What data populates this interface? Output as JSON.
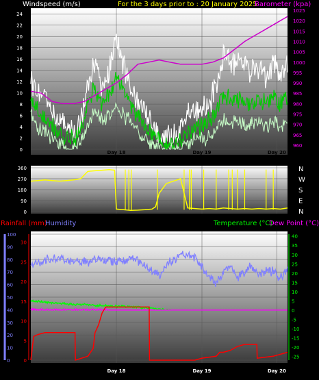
{
  "header": {
    "left_label": "Windspeed (m/s)",
    "center_label": "For the 3 days prior to : 20 January 2025",
    "right_label": "Barometer (kpa)"
  },
  "colors": {
    "background": "#000000",
    "wind_gust": "#ffffff",
    "wind_avg": "#00cc00",
    "wind_min": "#c8ffc8",
    "barometer": "#cc00cc",
    "direction": "#ffff00",
    "rainfall": "#ff0000",
    "humidity": "#8080ff",
    "temperature": "#00ff00",
    "dewpoint": "#ff00ff",
    "grid": "#555555"
  },
  "chart_data": [
    {
      "type": "line",
      "name": "wind-barometer",
      "x_tick_labels": [
        "Day 18",
        "Day 19",
        "Day 20"
      ],
      "y_left_ticks": [
        "0",
        "2",
        "4",
        "6",
        "8",
        "10",
        "12",
        "14",
        "16",
        "18",
        "20",
        "22",
        "24"
      ],
      "y_right_ticks": [
        "960",
        "965",
        "970",
        "975",
        "980",
        "985",
        "990",
        "995",
        "1000",
        "1005",
        "1010",
        "1015",
        "1020",
        "1025"
      ],
      "ylim_left": [
        0,
        25
      ],
      "ylim_right": [
        958,
        1026
      ],
      "xlim": [
        0,
        72
      ],
      "series": [
        {
          "role": "gust",
          "x": [
            0,
            2,
            4,
            6,
            8,
            10,
            12,
            14,
            16,
            18,
            20,
            22,
            24,
            26,
            28,
            30,
            32,
            34,
            36,
            38,
            40,
            42,
            44,
            46,
            48,
            50,
            52,
            54,
            56,
            58,
            60,
            62,
            64,
            66,
            68,
            70,
            72
          ],
          "values": [
            12,
            10,
            9,
            7,
            5,
            4,
            3,
            5,
            12,
            16,
            11,
            14,
            19,
            15,
            11,
            8,
            7,
            5,
            3,
            2,
            2,
            4,
            6,
            7,
            7,
            8,
            11,
            17,
            16,
            15,
            15,
            14,
            15,
            13,
            15,
            14,
            15
          ]
        },
        {
          "role": "avg",
          "x": [
            0,
            2,
            4,
            6,
            8,
            10,
            12,
            14,
            16,
            18,
            20,
            22,
            24,
            26,
            28,
            30,
            32,
            34,
            36,
            38,
            40,
            42,
            44,
            46,
            48,
            50,
            52,
            54,
            56,
            58,
            60,
            62,
            64,
            66,
            68,
            70,
            72
          ],
          "values": [
            9,
            7,
            5,
            4,
            3,
            2,
            2,
            3,
            8,
            11,
            8,
            10,
            13,
            10,
            8,
            6,
            4,
            3,
            2,
            1,
            1,
            2,
            3,
            4,
            4,
            5,
            7,
            10,
            9,
            9,
            8,
            8,
            9,
            8,
            9,
            8,
            9
          ]
        },
        {
          "role": "min",
          "x": [
            0,
            2,
            4,
            6,
            8,
            10,
            12,
            14,
            16,
            18,
            20,
            22,
            24,
            26,
            28,
            30,
            32,
            34,
            36,
            38,
            40,
            42,
            44,
            46,
            48,
            50,
            52,
            54,
            56,
            58,
            60,
            62,
            64,
            66,
            68,
            70,
            72
          ],
          "values": [
            6,
            4,
            3,
            2,
            1,
            0,
            0,
            1,
            4,
            7,
            5,
            6,
            8,
            6,
            5,
            3,
            2,
            1,
            0,
            0,
            0,
            0,
            1,
            2,
            2,
            2,
            4,
            5,
            5,
            5,
            4,
            5,
            5,
            4,
            5,
            4,
            5
          ]
        },
        {
          "role": "barometer",
          "axis": "right",
          "x": [
            0,
            3,
            6,
            9,
            12,
            15,
            18,
            21,
            24,
            27,
            30,
            33,
            36,
            39,
            42,
            45,
            48,
            51,
            54,
            57,
            60,
            63,
            66,
            69,
            72
          ],
          "values": [
            986,
            985,
            981,
            980,
            980,
            981,
            984,
            987,
            990,
            994,
            999,
            1000,
            1001,
            1000,
            999,
            999,
            999,
            1000,
            1002,
            1006,
            1010,
            1013,
            1016,
            1019,
            1022
          ]
        }
      ]
    },
    {
      "type": "line",
      "name": "wind-direction",
      "x_tick_labels": [
        "Day 18",
        "Day 19",
        "Day 20"
      ],
      "y_ticks": [
        "0",
        "90",
        "180",
        "270",
        "360"
      ],
      "compass_labels": [
        "N",
        "W",
        "S",
        "E",
        "N"
      ],
      "ylim": [
        0,
        360
      ],
      "xlim": [
        0,
        72
      ],
      "series": [
        {
          "role": "direction",
          "x": [
            0,
            2,
            4,
            6,
            8,
            10,
            12,
            14,
            16,
            18,
            20,
            22,
            23.5,
            24,
            26,
            28,
            30,
            32,
            34,
            35,
            36,
            38,
            40,
            42,
            44,
            46,
            48,
            50,
            52,
            54,
            56,
            58,
            60,
            62,
            64,
            66,
            68,
            70,
            72
          ],
          "values": [
            250,
            255,
            260,
            255,
            250,
            255,
            260,
            270,
            330,
            335,
            340,
            345,
            340,
            20,
            15,
            10,
            12,
            15,
            20,
            40,
            150,
            230,
            250,
            270,
            30,
            25,
            20,
            25,
            20,
            30,
            25,
            20,
            25,
            20,
            25,
            20,
            25,
            20,
            30
          ]
        }
      ]
    },
    {
      "type": "line",
      "name": "rain-humidity-temperature",
      "labels": {
        "rainfall": "Rainfall (mm)",
        "humidity": "Humidity",
        "temperature": "Temperature (°C)",
        "dewpoint": "Dew Point (°C)"
      },
      "x_tick_labels": [
        "Day 18",
        "Day 19",
        "Day 20"
      ],
      "y_humidity_ticks": [
        "0",
        "10",
        "20",
        "30",
        "40",
        "50",
        "60",
        "70",
        "80",
        "90",
        "100"
      ],
      "y_rain_ticks": [
        "0",
        "5",
        "10",
        "15",
        "20",
        "25",
        "30"
      ],
      "y_temp_ticks": [
        "-25",
        "-20",
        "-15",
        "-10",
        "-5",
        "0",
        "5",
        "10",
        "15",
        "20",
        "25",
        "30",
        "35",
        "40"
      ],
      "ylim_humidity": [
        0,
        100
      ],
      "ylim_rain": [
        0,
        32
      ],
      "ylim_temp": [
        -27,
        41
      ],
      "xlim": [
        0,
        72
      ],
      "series": [
        {
          "role": "humidity",
          "x": [
            0,
            2,
            4,
            6,
            8,
            10,
            12,
            14,
            16,
            18,
            20,
            22,
            24,
            26,
            28,
            30,
            32,
            34,
            36,
            38,
            40,
            42,
            44,
            46,
            48,
            50,
            52,
            54,
            56,
            58,
            60,
            62,
            64,
            66,
            68,
            70,
            72
          ],
          "values": [
            75,
            77,
            80,
            80,
            80,
            79,
            79,
            78,
            78,
            79,
            79,
            79,
            79,
            80,
            80,
            79,
            74,
            70,
            67,
            75,
            80,
            83,
            84,
            82,
            75,
            66,
            60,
            70,
            75,
            65,
            70,
            75,
            68,
            72,
            70,
            65,
            72
          ]
        },
        {
          "role": "temperature",
          "axis": "temp",
          "x": [
            0,
            3,
            6,
            9,
            12,
            15,
            18,
            21,
            24,
            27,
            30,
            33,
            36,
            39,
            42,
            45,
            48,
            51,
            54,
            57,
            60,
            63,
            66,
            69,
            72
          ],
          "values": [
            5,
            4.5,
            4,
            3.5,
            3,
            3,
            2.5,
            2.5,
            2,
            2,
            1.5,
            1,
            0.5,
            0,
            -1,
            -2,
            -3,
            -4,
            -5,
            -6,
            -6.5,
            -7,
            -7.5,
            -7.5,
            -8
          ]
        },
        {
          "role": "dewpoint",
          "axis": "temp",
          "x": [
            0,
            3,
            6,
            9,
            12,
            15,
            18,
            21,
            24,
            27,
            30,
            33,
            36,
            39,
            42,
            45,
            48,
            51,
            54,
            57,
            60,
            63,
            66,
            69,
            72
          ],
          "values": [
            0,
            0,
            0,
            0,
            0,
            0,
            0,
            0,
            -0.5,
            -1,
            -2,
            -3,
            -4,
            -4.5,
            -5,
            -6,
            -8,
            -12,
            -15,
            -15,
            -14,
            -14,
            -14,
            -13,
            -13
          ]
        },
        {
          "role": "rainfall",
          "axis": "rain",
          "x": [
            0,
            0.8,
            2,
            4,
            7,
            9.5,
            12.4,
            12.5,
            16,
            17.5,
            18,
            19,
            20,
            21,
            24,
            28,
            32,
            33.2,
            33.3,
            40,
            46,
            48,
            52,
            53,
            54,
            56,
            58,
            60,
            62,
            63.4,
            63.5,
            68,
            72
          ],
          "values": [
            0,
            6,
            6.5,
            7,
            7,
            7,
            7,
            0,
            1,
            3,
            7,
            9,
            12,
            13.5,
            13.5,
            13.5,
            13.5,
            13.5,
            0,
            0,
            0,
            0.5,
            1,
            2,
            2,
            2.5,
            3.5,
            4,
            4,
            4,
            0.5,
            1,
            2
          ]
        }
      ]
    }
  ]
}
